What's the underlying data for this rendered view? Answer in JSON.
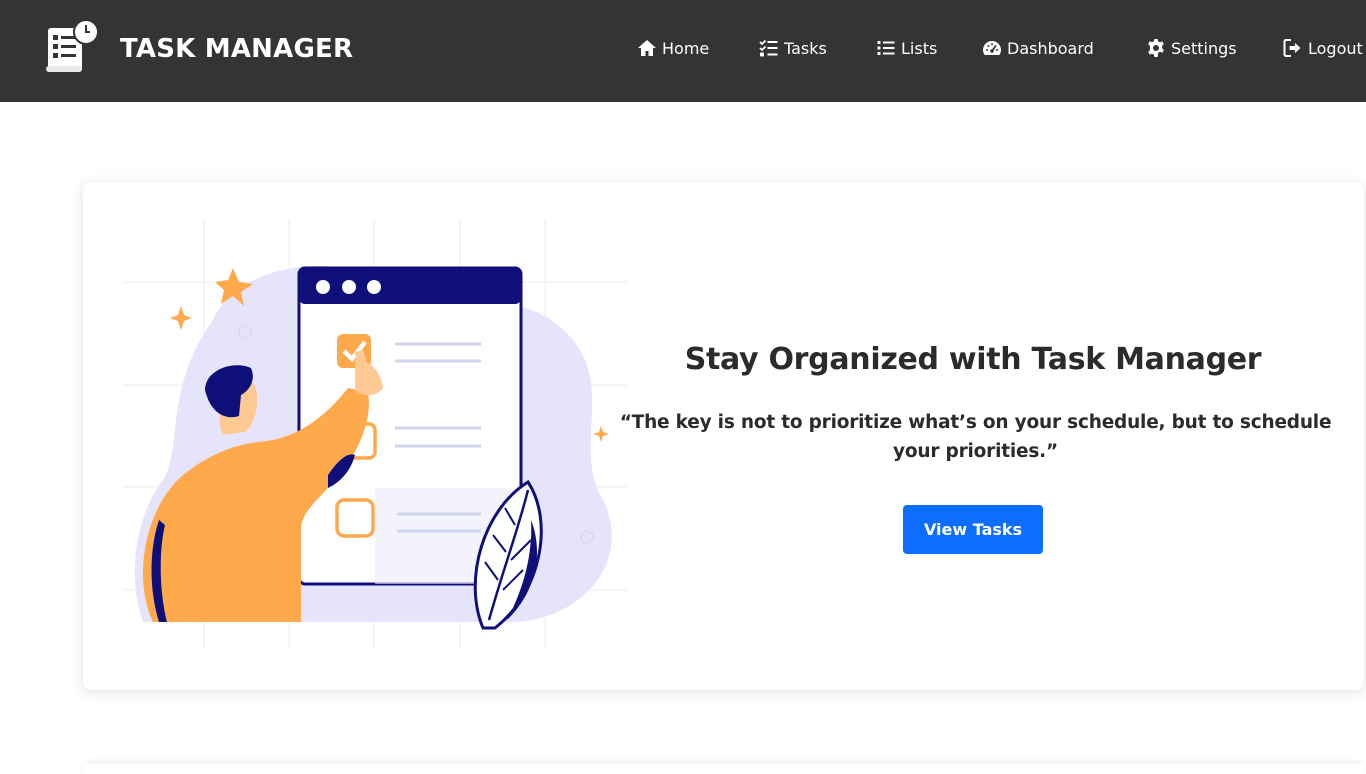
{
  "brand": {
    "title": "TASK MANAGER",
    "logo_icon": "task-list-clock-icon"
  },
  "nav": {
    "items": [
      {
        "label": "Home",
        "icon": "home-icon"
      },
      {
        "label": "Tasks",
        "icon": "tasks-checklist-icon"
      },
      {
        "label": "Lists",
        "icon": "list-icon"
      },
      {
        "label": "Dashboard",
        "icon": "dashboard-gauge-icon"
      },
      {
        "label": "Settings",
        "icon": "gear-icon"
      },
      {
        "label": "Logout",
        "icon": "logout-icon"
      }
    ]
  },
  "hero": {
    "title": "Stay Organized with Task Manager",
    "quote": "“The key is not to prioritize what’s on your schedule, but to schedule your priorities.”",
    "button_label": "View Tasks"
  },
  "colors": {
    "navbar_bg": "#343434",
    "button_bg": "#0d6efd",
    "illustration_orange": "#ffa94d",
    "illustration_navy": "#0f0f7a",
    "illustration_lavender": "#e6e4fb"
  }
}
